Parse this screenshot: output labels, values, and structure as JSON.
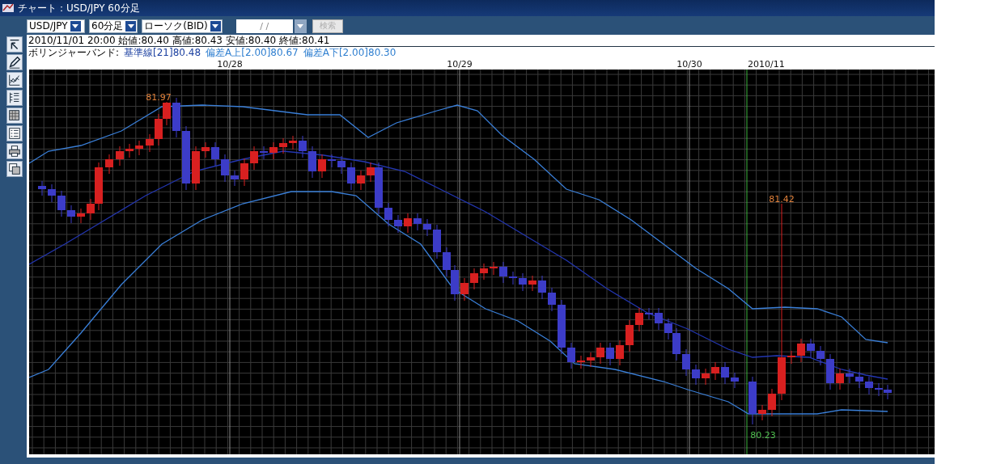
{
  "window": {
    "title": "チャート：USD/JPY 60分足"
  },
  "toolbar": {
    "symbol": "USD/JPY",
    "period": "60分足",
    "chart_type": "ローソク(BID)",
    "date_field": {
      "value": "/ /",
      "disabled": false
    },
    "date_dropdown": {
      "disabled": true
    },
    "search_button": {
      "label": "検索",
      "disabled": true
    }
  },
  "info": {
    "ohlc": "2010/11/01 20:00 始値:80.40 高値:80.43 安値:80.40 終値:80.41",
    "bollinger_label": "ボリンジャーバンド:",
    "bollinger": [
      {
        "text": "基準線[21]80.48",
        "color": "#1a3fa0"
      },
      {
        "text": "偏差A上[2.00]80.67",
        "color": "#2f7fd0"
      },
      {
        "text": "偏差A下[2.00]80.30",
        "color": "#2f7fd0"
      }
    ]
  },
  "chart": {
    "date_labels": [
      "10/28",
      "10/29",
      "10/30",
      "2010/11"
    ],
    "annotations": [
      {
        "text": "81.97",
        "color": "#e0803a"
      },
      {
        "text": "81.42",
        "color": "#e0803a"
      },
      {
        "text": "80.23",
        "color": "#4fbf4f"
      }
    ]
  }
}
